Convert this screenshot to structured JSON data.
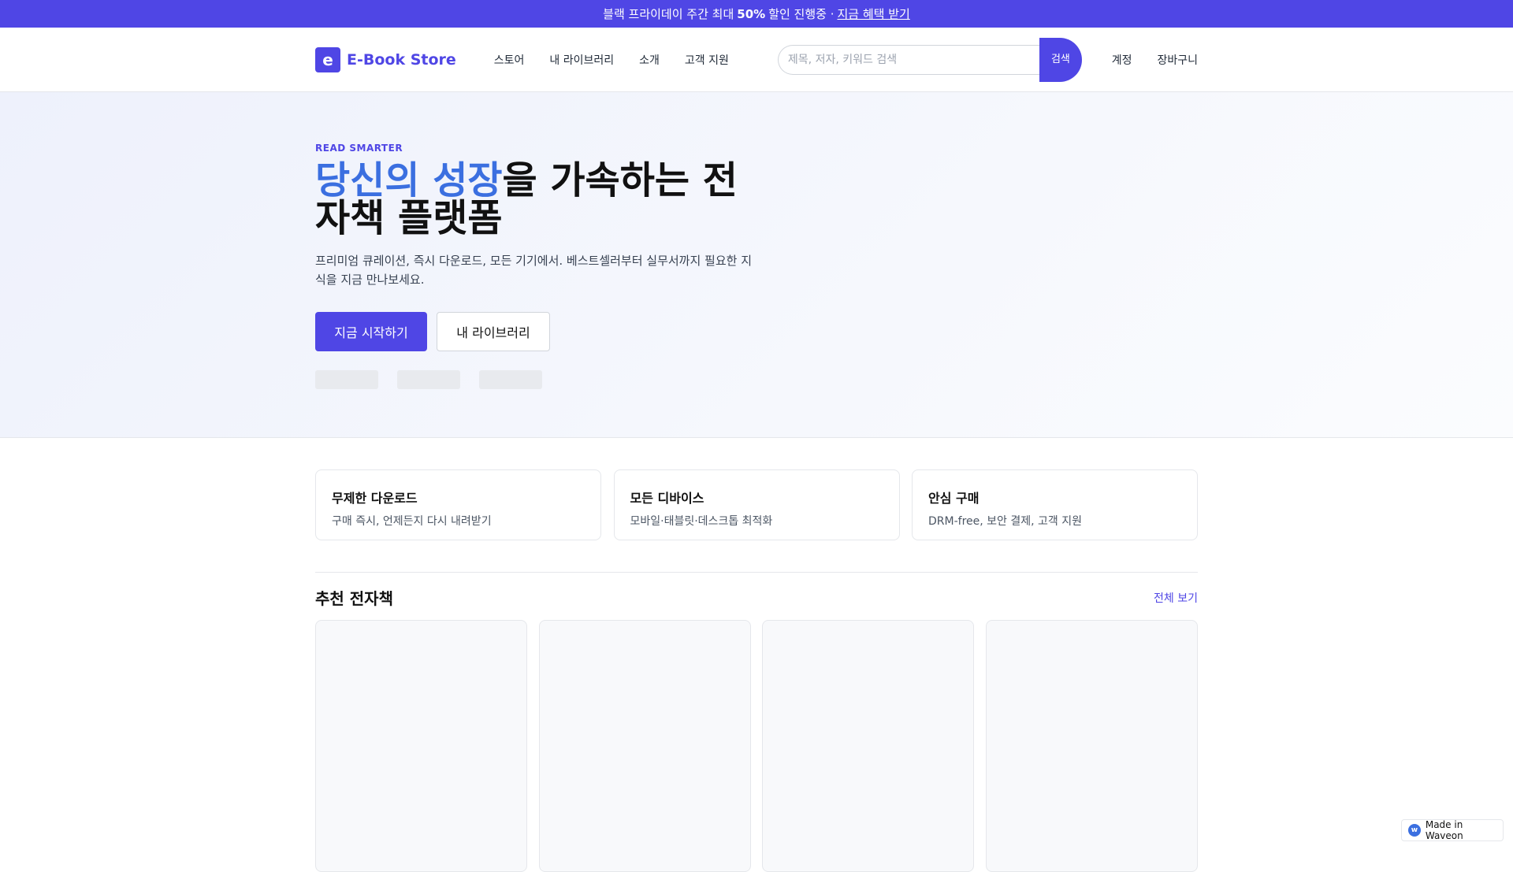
{
  "promo": {
    "text": "블랙 프라이데이 주간 최대",
    "highlight": "50%",
    "suffix": "할인 진행중 ·",
    "link": "지금 혜택 받기"
  },
  "header": {
    "logo_mark": "e",
    "logo_text": "E-Book Store",
    "nav": [
      "스토어",
      "내 라이브러리",
      "소개",
      "고객 지원"
    ],
    "search_placeholder": "제목, 저자, 키워드 검색",
    "search_button": "검색",
    "account": "계정",
    "cart": "장바구니"
  },
  "hero": {
    "eyebrow": "READ SMARTER",
    "title_accent": "당신의 성장",
    "title_rest": "을 가속하는 전자책 플랫폼",
    "description": "프리미엄 큐레이션, 즉시 다운로드, 모든 기기에서. 베스트셀러부터 실무서까지 필요한 지식을 지금 만나보세요.",
    "primary_cta": "지금 시작하기",
    "secondary_cta": "내 라이브러리"
  },
  "features": [
    {
      "title": "무제한 다운로드",
      "desc": "구매 즉시, 언제든지 다시 내려받기"
    },
    {
      "title": "모든 디바이스",
      "desc": "모바일·태블릿·데스크톱 최적화"
    },
    {
      "title": "안심 구매",
      "desc": "DRM-free, 보안 결제, 고객 지원"
    }
  ],
  "recommended": {
    "title": "추천 전자책",
    "view_all": "전체 보기"
  },
  "badge": {
    "icon_char": "w",
    "label": "Made in Waveon"
  }
}
